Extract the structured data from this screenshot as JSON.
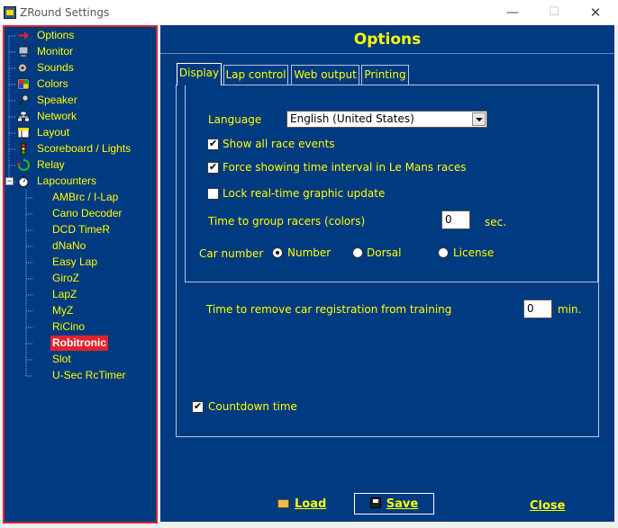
{
  "window": {
    "title": "ZRound Settings"
  },
  "tree": {
    "items": [
      {
        "label": "Options",
        "icon": "arrow-icon"
      },
      {
        "label": "Monitor",
        "icon": "monitor-icon"
      },
      {
        "label": "Sounds",
        "icon": "sounds-icon"
      },
      {
        "label": "Colors",
        "icon": "colors-icon"
      },
      {
        "label": "Speaker",
        "icon": "speaker-icon"
      },
      {
        "label": "Network",
        "icon": "network-icon"
      },
      {
        "label": "Layout",
        "icon": "layout-icon"
      },
      {
        "label": "Scoreboard / Lights",
        "icon": "traffic-light-icon"
      },
      {
        "label": "Relay",
        "icon": "relay-icon"
      },
      {
        "label": "Lapcounters",
        "icon": "stopwatch-icon"
      }
    ],
    "lapcounters": [
      "AMBrc / I-Lap",
      "Cano Decoder",
      "DCD TimeR",
      "dNaNo",
      "Easy Lap",
      "GiroZ",
      "LapZ",
      "MyZ",
      "RiCino",
      "Robitronic",
      "Slot",
      "U-Sec RcTimer"
    ],
    "selected": "Robitronic"
  },
  "panel": {
    "title": "Options"
  },
  "tabs": [
    "Display",
    "Lap control",
    "Web output",
    "Printing"
  ],
  "display": {
    "language_label": "Language",
    "language_value": "English (United States)",
    "show_all_race_events": "Show all race events",
    "force_time_interval": "Force showing time interval in Le Mans races",
    "lock_realtime": "Lock real-time graphic update",
    "group_racers_label": "Time to group racers (colors)",
    "group_racers_value": "0",
    "group_racers_unit": "sec.",
    "car_number_label": "Car number",
    "car_number_options": [
      "Number",
      "Dorsal",
      "License"
    ],
    "car_number_selected": "Number",
    "remove_car_label": "Time to remove car registration  from training",
    "remove_car_value": "0",
    "remove_car_unit": "min.",
    "countdown_label": "Countdown time",
    "checks": {
      "show_all_race_events": true,
      "force_time_interval": true,
      "lock_realtime": false,
      "countdown": true
    }
  },
  "buttons": {
    "load": "Load",
    "save": "Save",
    "close": "Close"
  },
  "colors": {
    "panel_bg": "#003a80",
    "text": "#ffff00",
    "selection": "#e0242c"
  }
}
